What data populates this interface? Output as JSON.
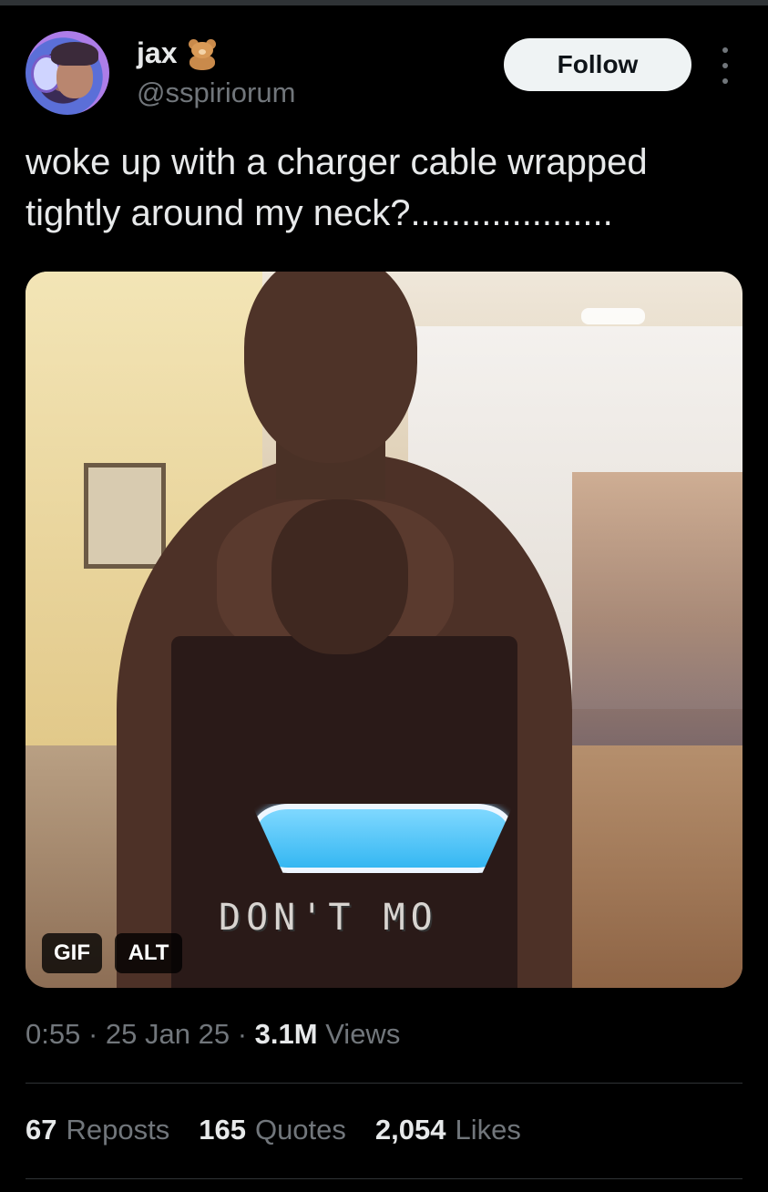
{
  "user": {
    "display_name": "jax",
    "emoji_icon": "teddy-bear-icon",
    "handle": "@sspiriorum"
  },
  "actions": {
    "follow_label": "Follow",
    "more_icon": "more-dots-icon"
  },
  "tweet": {
    "text": "woke up with a charger cable wrapped\ntightly around my neck?...................."
  },
  "media": {
    "caption_overlay": "DON'T MO",
    "gif_badge": "GIF",
    "alt_badge": "ALT"
  },
  "meta": {
    "time": "0:55",
    "separator": " · ",
    "date": "25 Jan 25",
    "views_count": "3.1M",
    "views_label": "Views"
  },
  "stats": {
    "reposts_count": "67",
    "reposts_label": "Reposts",
    "quotes_count": "165",
    "quotes_label": "Quotes",
    "likes_count": "2,054",
    "likes_label": "Likes"
  },
  "colors": {
    "background": "#000000",
    "text_primary": "#e7e9ea",
    "text_secondary": "#71767b",
    "follow_button_bg": "#eff3f4",
    "divider": "#2f3336"
  }
}
